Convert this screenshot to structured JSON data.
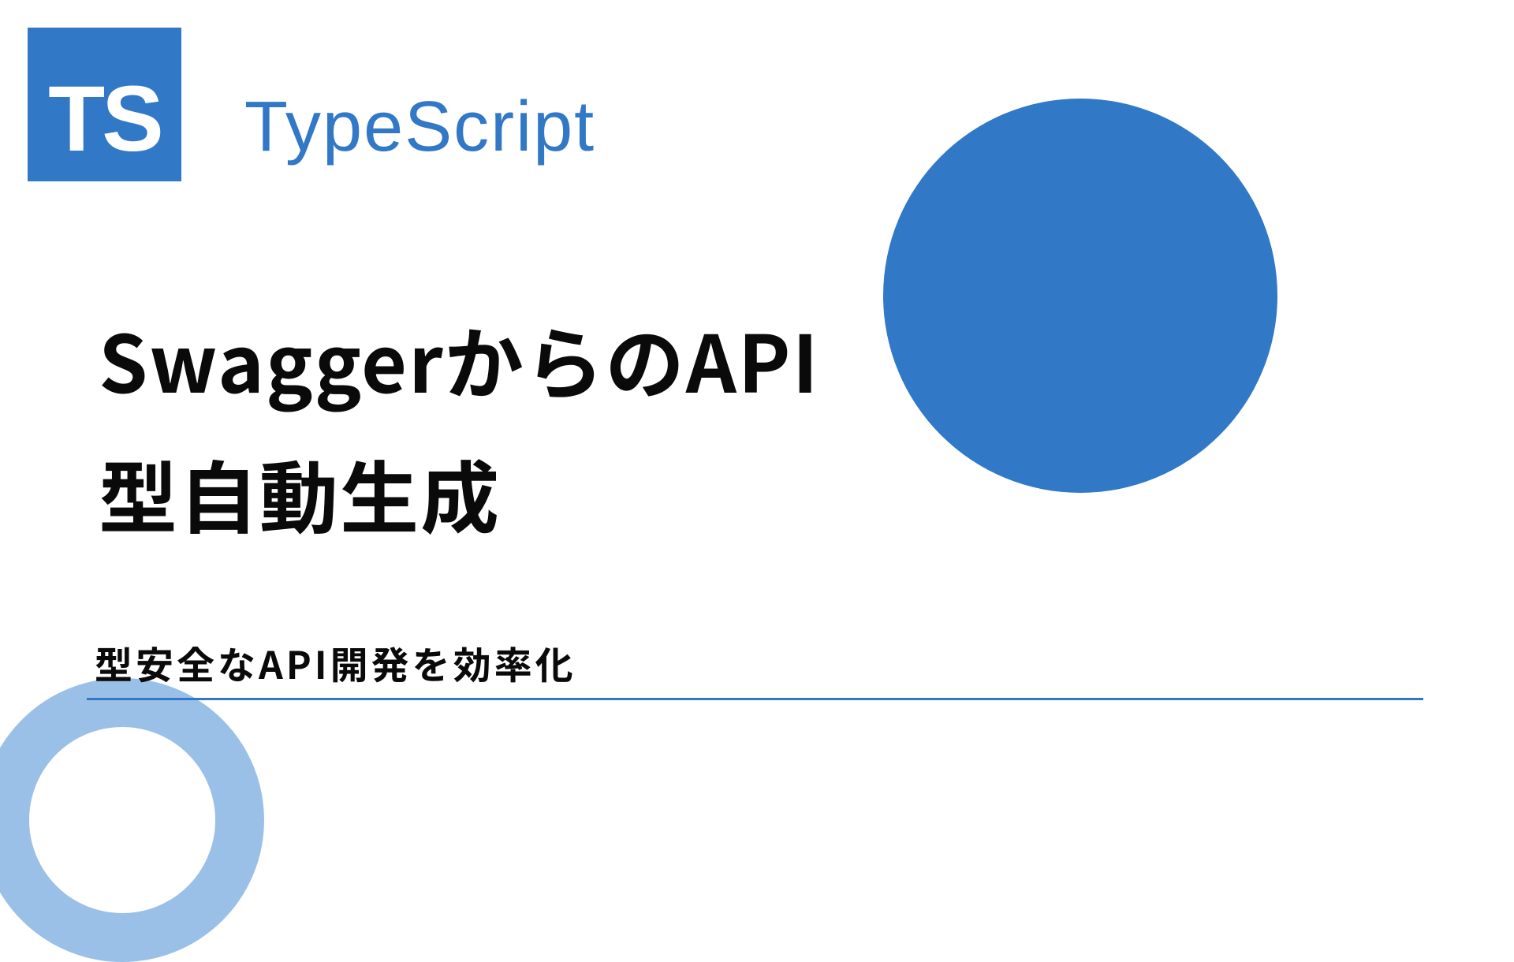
{
  "logo": {
    "text": "TS"
  },
  "header": {
    "title": "TypeScript"
  },
  "main": {
    "title_line1": "SwaggerからのAPI",
    "title_line2": "型自動生成"
  },
  "subtitle": "型安全なAPI開発を効率化",
  "colors": {
    "primary": "#3178c6",
    "ring": "#9bc0e8",
    "text": "#0a0a0a"
  }
}
